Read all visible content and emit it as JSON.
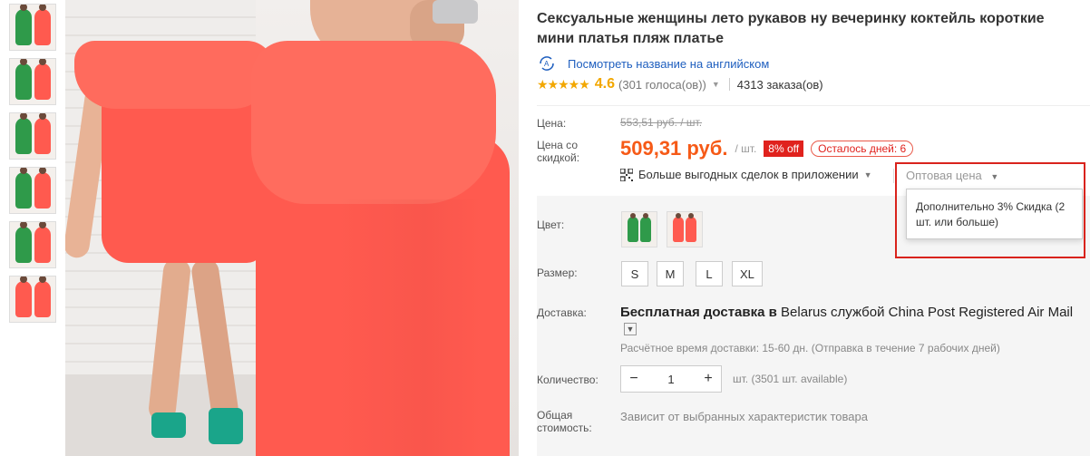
{
  "thumbnails": [
    {
      "label": "thumb-1",
      "colors": [
        "green",
        "coral"
      ]
    },
    {
      "label": "thumb-2",
      "colors": [
        "green",
        "coral"
      ]
    },
    {
      "label": "thumb-3",
      "colors": [
        "green",
        "coral"
      ]
    },
    {
      "label": "thumb-4",
      "colors": [
        "green",
        "coral"
      ]
    },
    {
      "label": "thumb-5",
      "colors": [
        "green",
        "coral"
      ]
    },
    {
      "label": "thumb-6",
      "colors": [
        "coral",
        "coral"
      ]
    }
  ],
  "product": {
    "title": "Сексуальные женщины лето рукавов ну вечеринку коктейль короткие мини платья пляж платье",
    "translate_link": "Посмотреть название на английском",
    "stars": "★★★★★",
    "rating": "4.6",
    "votes": "(301 голоса(ов))",
    "orders": "4313 заказа(ов)"
  },
  "pricing": {
    "price_label": "Цена:",
    "original_price": "553,51 руб. / шт.",
    "discount_label": "Цена со скидкой:",
    "price": "509,31 руб.",
    "unit": "/ шт.",
    "discount_badge": "8% off",
    "days_left": "Осталось дней: 6",
    "app_deals": "Больше выгодных сделок в приложении",
    "wholesale_trigger": "Оптовая цена",
    "wholesale_popup": "Дополнительно 3% Скидка (2 шт. или больше)"
  },
  "options": {
    "color_label": "Цвет:",
    "size_label": "Размер:",
    "sizes": [
      "S",
      "M",
      "L",
      "XL"
    ]
  },
  "shipping": {
    "label": "Доставка:",
    "bold_prefix": "Бесплатная доставка в",
    "destination": "Belarus службой China Post Registered Air Mail",
    "estimate": "Расчётное время доставки: 15-60 дн. (Отправка в течение 7 рабочих дней)"
  },
  "quantity": {
    "label": "Количество:",
    "value": "1",
    "minus": "−",
    "plus": "+",
    "note": "шт. (3501 шт. available)"
  },
  "total": {
    "label": "Общая стоимость:",
    "note": "Зависит от выбранных характеристик товара"
  },
  "colors": {
    "accent_price": "#f65a17",
    "rating_star": "#f2a700",
    "badge_red": "#e0221d",
    "highlight_box": "#d9231c",
    "link_blue": "#1f5fbf",
    "dress_coral": "#ff5a4f",
    "dress_green": "#2f9a4a"
  }
}
